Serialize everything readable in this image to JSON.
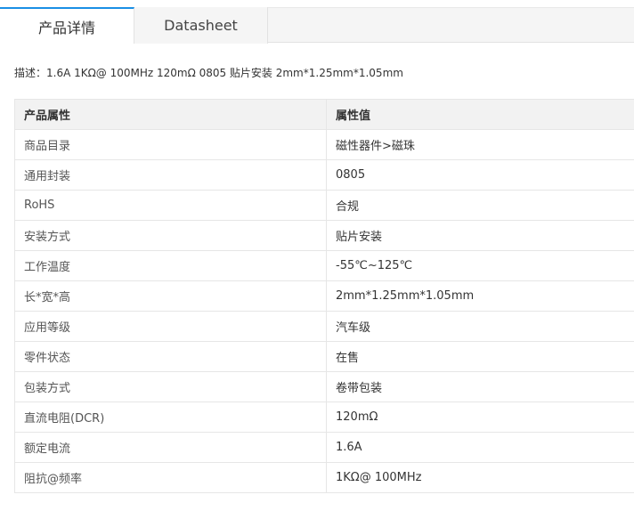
{
  "tabs": [
    {
      "label": "产品详情",
      "active": true
    },
    {
      "label": "Datasheet",
      "active": false
    }
  ],
  "description": "描述：1.6A 1KΩ@ 100MHz 120mΩ 0805 贴片安装 2mm*1.25mm*1.05mm",
  "table": {
    "headers": [
      "产品属性",
      "属性值"
    ],
    "rows": [
      {
        "name": "商品目录",
        "value": "磁性器件>磁珠"
      },
      {
        "name": "通用封装",
        "value": "0805"
      },
      {
        "name": "RoHS",
        "value": "合规"
      },
      {
        "name": "安装方式",
        "value": "贴片安装"
      },
      {
        "name": "工作温度",
        "value": "-55℃~125℃"
      },
      {
        "name": "长*宽*高",
        "value": "2mm*1.25mm*1.05mm"
      },
      {
        "name": "应用等级",
        "value": "汽车级"
      },
      {
        "name": "零件状态",
        "value": "在售"
      },
      {
        "name": "包装方式",
        "value": "卷带包装"
      },
      {
        "name": "直流电阻(DCR)",
        "value": "120mΩ"
      },
      {
        "name": "额定电流",
        "value": "1.6A"
      },
      {
        "name": "阻抗@频率",
        "value": "1KΩ@ 100MHz"
      }
    ]
  },
  "colors": {
    "accent": "#1a8fe5",
    "header_bg": "#f2f2f2",
    "border": "#e6e6e6"
  }
}
